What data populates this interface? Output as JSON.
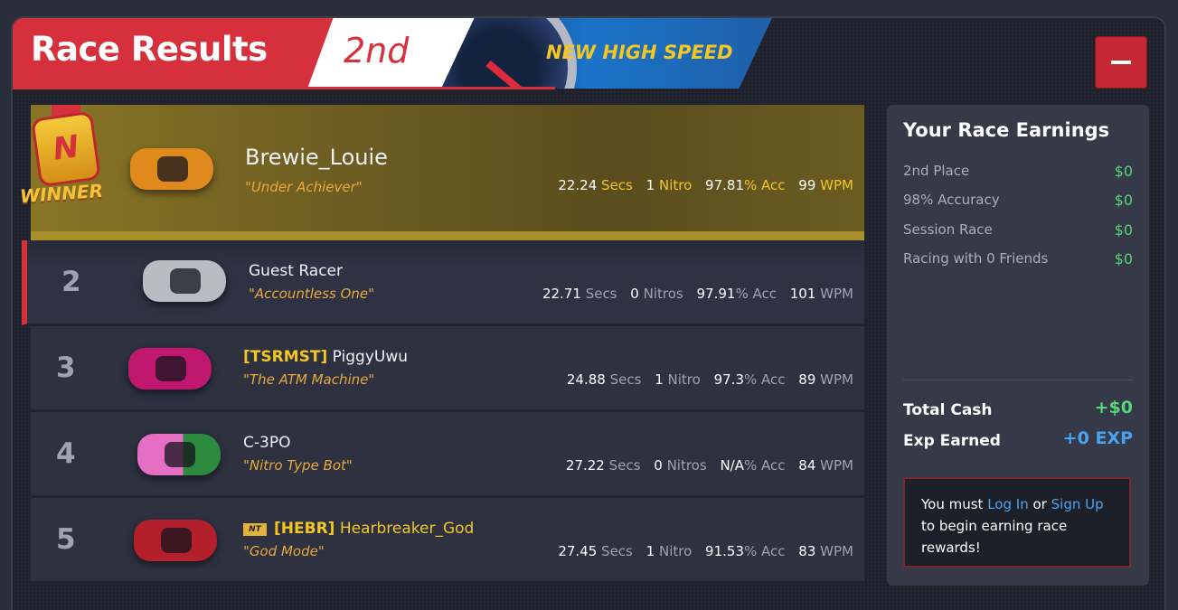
{
  "header": {
    "title": "Race Results",
    "place": "2nd",
    "banner": "NEW HIGH SPEED",
    "minimize_icon": "minus-icon"
  },
  "winner": {
    "badge": "WINNER",
    "badge_icon_letter": "N",
    "name": "Brewie_Louie",
    "title": "\"Under Achiever\"",
    "time": "22.24",
    "time_unit": "Secs",
    "nitro": "1",
    "nitro_unit": "Nitro",
    "acc": "97.81",
    "acc_unit": "% Acc",
    "wpm": "99",
    "wpm_unit": "WPM",
    "car_color": "#e08a1e"
  },
  "racers": [
    {
      "rank": "2",
      "tag": "",
      "nt": "",
      "name": "Guest Racer",
      "title": "\"Accountless One\"",
      "time": "22.71",
      "time_unit": "Secs",
      "nitro": "0",
      "nitro_unit": "Nitros",
      "acc": "97.91",
      "acc_unit": "% Acc",
      "wpm": "101",
      "wpm_unit": "WPM",
      "car_color": "#b9bcc2"
    },
    {
      "rank": "3",
      "tag": "[TSRMST]",
      "nt": "",
      "name": "PiggyUwu",
      "title": "\"The ATM Machine\"",
      "time": "24.88",
      "time_unit": "Secs",
      "nitro": "1",
      "nitro_unit": "Nitro",
      "acc": "97.3",
      "acc_unit": "% Acc",
      "wpm": "89",
      "wpm_unit": "WPM",
      "car_color": "#c0186f"
    },
    {
      "rank": "4",
      "tag": "",
      "nt": "",
      "name": "C-3PO",
      "title": "\"Nitro Type Bot\"",
      "time": "27.22",
      "time_unit": "Secs",
      "nitro": "0",
      "nitro_unit": "Nitros",
      "acc": "N/A",
      "acc_unit": "% Acc",
      "wpm": "84",
      "wpm_unit": "WPM",
      "car_color": "#e46fc4"
    },
    {
      "rank": "5",
      "tag": "[HEBR]",
      "nt": "NT",
      "name": "Hearbreaker_God",
      "title": "\"God Mode\"",
      "time": "27.45",
      "time_unit": "Secs",
      "nitro": "1",
      "nitro_unit": "Nitro",
      "acc": "91.53",
      "acc_unit": "% Acc",
      "wpm": "83",
      "wpm_unit": "WPM",
      "car_color": "#b3202c"
    }
  ],
  "earnings": {
    "heading": "Your Race Earnings",
    "items": [
      {
        "label": "2nd Place",
        "value": "$0"
      },
      {
        "label": "98% Accuracy",
        "value": "$0"
      },
      {
        "label": "Session Race",
        "value": "$0"
      },
      {
        "label": "Racing with 0 Friends",
        "value": "$0"
      }
    ],
    "total_cash_label": "Total Cash",
    "total_cash_value": "+$0",
    "exp_label": "Exp Earned",
    "exp_value": "+0 EXP",
    "notice_pre": "You must",
    "login": "Log In",
    "or": "or",
    "signup": "Sign Up",
    "notice_post": "to begin earning race rewards!"
  }
}
